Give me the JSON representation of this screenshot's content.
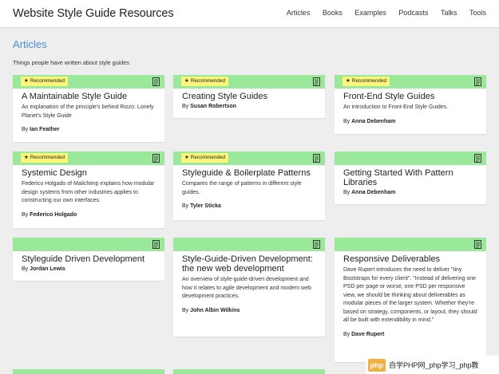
{
  "header": {
    "title": "Website Style Guide Resources",
    "nav": [
      "Articles",
      "Books",
      "Examples",
      "Podcasts",
      "Talks",
      "Tools"
    ]
  },
  "section": {
    "title": "Articles",
    "description": "Things people have written about style guides"
  },
  "badge_label": "Recommended",
  "by_label": "By",
  "colors": {
    "band": "#9ae89a",
    "badge": "#fdf57a",
    "accent": "#4a8fd0"
  },
  "cards": [
    {
      "title": "A Maintainable Style Guide",
      "description": "An explanation of the principle's behind Rizzo: Lonely Planet's Style Guide",
      "author": "Ian Feather",
      "recommended": true
    },
    {
      "title": "Creating Style Guides",
      "description": "",
      "author": "Susan Robertson",
      "recommended": true
    },
    {
      "title": "Front-End Style Guides",
      "description": "An introduction to Front-End Style Guides.",
      "author": "Anna Debenham",
      "recommended": true
    },
    {
      "title": "Systemic Design",
      "description": "Federico Holgado of Mailchimp explains how modular design systems from other industries applies to constructing our own interfaces.",
      "author": "Federico Holgado",
      "recommended": true
    },
    {
      "title": "Styleguide & Boilerplate Patterns",
      "description": "Compares the range of patterns in different style guides.",
      "author": "Tyler Sticka",
      "recommended": true
    },
    {
      "title": "Getting Started With Pattern Libraries",
      "description": "",
      "author": "Anna Debenham",
      "recommended": false
    },
    {
      "title": "Styleguide Driven Development",
      "description": "",
      "author": "Jordan Lewis",
      "recommended": false
    },
    {
      "title": "Style-Guide-Driven Development: the new web development",
      "description": "An overview of style-guide-driven development and how it relates to agile development and modern web development practices.",
      "author": "John Albin Wilkins",
      "recommended": false
    },
    {
      "title": "Responsive Deliverables",
      "description": "Dave Rupert introduces the need to deliver \"tiny Bootstraps for every client\". \"Instead of delivering one PSD per page or worse, one PSD per responsive view, we should be thinking about deliverables as modular pieces of the larger system. Whether they're based on strategy, components, or layout, they should all be built with extendibility in mind.\"",
      "author": "Dave Rupert",
      "recommended": false
    }
  ],
  "watermark": {
    "logo_text": "php",
    "text": "自学PHP网_php学习_php教"
  }
}
